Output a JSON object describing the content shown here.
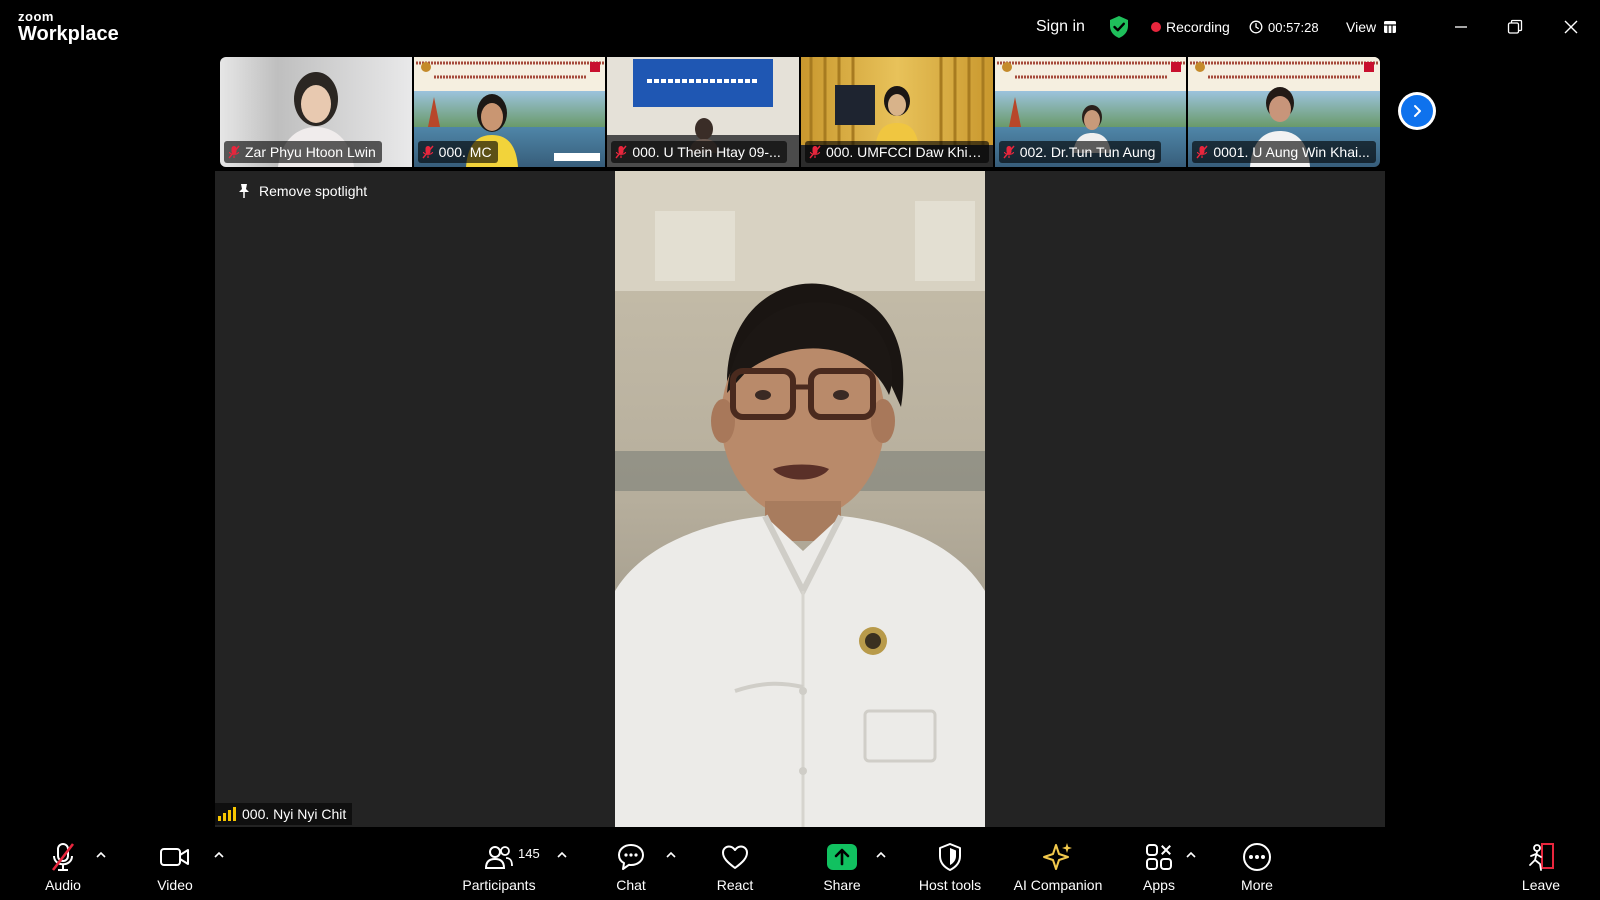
{
  "app": {
    "logo_top": "zoom",
    "logo_bottom": "Workplace"
  },
  "titlebar": {
    "sign_in": "Sign in",
    "recording": "Recording",
    "timer": "00:57:28",
    "view": "View"
  },
  "thumbnails": [
    {
      "name": "Zar Phyu Htoon Lwin"
    },
    {
      "name": "000. MC"
    },
    {
      "name": "000. U Thein Htay 09-..."
    },
    {
      "name": "000. UMFCCI Daw Khin..."
    },
    {
      "name": "002. Dr.Tun Tun Aung"
    },
    {
      "name": "0001. U Aung Win Khai..."
    }
  ],
  "stage": {
    "spotlight_label": "Remove spotlight",
    "speaker_name": "000. Nyi Nyi Chit"
  },
  "toolbar": {
    "audio": "Audio",
    "video": "Video",
    "participants": "Participants",
    "participants_count": "145",
    "chat": "Chat",
    "react": "React",
    "share": "Share",
    "host_tools": "Host tools",
    "ai_companion": "AI Companion",
    "apps": "Apps",
    "more": "More",
    "leave": "Leave"
  },
  "colors": {
    "recording_dot": "#e8263d",
    "share_green": "#11c160",
    "shield_green": "#1fbf5b",
    "next_blue": "#0e72ed",
    "ai_star": "#f2c94c",
    "leave_red": "#e8263d"
  }
}
